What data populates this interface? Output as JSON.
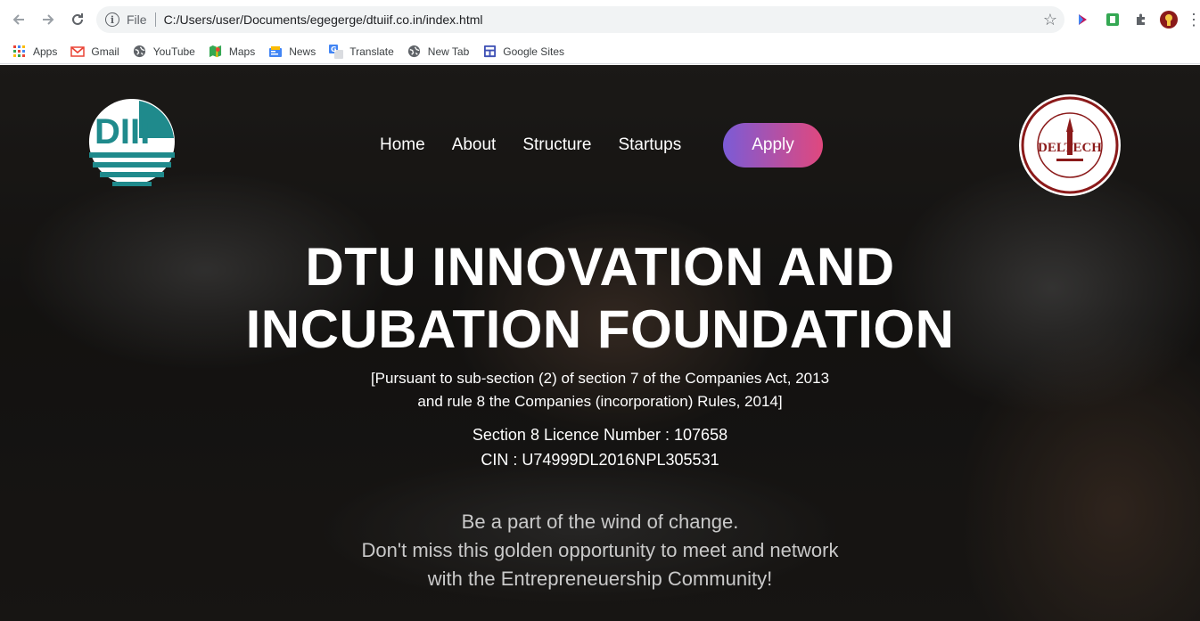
{
  "browser": {
    "file_label": "File",
    "url": "C:/Users/user/Documents/egegerge/dtuiif.co.in/index.html",
    "bookmarks": [
      {
        "label": "Apps",
        "icon": "apps-grid-icon"
      },
      {
        "label": "Gmail",
        "icon": "gmail-icon"
      },
      {
        "label": "YouTube",
        "icon": "globe-icon"
      },
      {
        "label": "Maps",
        "icon": "maps-icon"
      },
      {
        "label": "News",
        "icon": "news-icon"
      },
      {
        "label": "Translate",
        "icon": "translate-icon"
      },
      {
        "label": "New Tab",
        "icon": "globe-icon"
      },
      {
        "label": "Google Sites",
        "icon": "sites-icon"
      }
    ]
  },
  "nav": {
    "home": "Home",
    "about": "About",
    "structure": "Structure",
    "startups": "Startups",
    "apply": "Apply"
  },
  "logo": {
    "text": "DIIF"
  },
  "seal": {
    "text": "DELTECH"
  },
  "hero": {
    "title_line1": "DTU INNOVATION AND",
    "title_line2": "INCUBATION FOUNDATION",
    "pursuant_line1": "[Pursuant to sub-section (2) of section 7 of the Companies Act, 2013",
    "pursuant_line2": "and rule 8 the Companies (incorporation) Rules, 2014]",
    "licence": "Section 8 Licence Number : 107658",
    "cin": "CIN : U74999DL2016NPL305531",
    "tagline1": "Be a part of the wind of change.",
    "tagline2": "Don't miss this golden opportunity to meet and network",
    "tagline3": "with the Entrepreneuership Community!"
  },
  "colors": {
    "apply_gradient_start": "#7b5bd6",
    "apply_gradient_end": "#e0487e",
    "logo_teal": "#1f8a8c",
    "seal_red": "#8b1a1a"
  }
}
